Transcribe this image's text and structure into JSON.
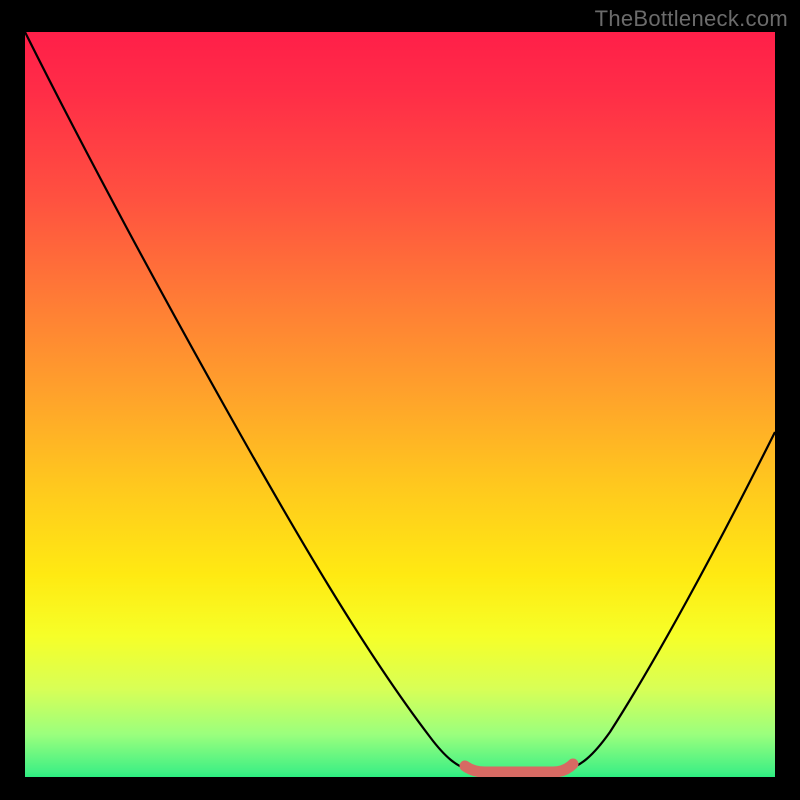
{
  "watermark": "TheBottleneck.com",
  "colors": {
    "background": "#000000",
    "gradient_top": "#ff1f49",
    "gradient_mid": "#ffea12",
    "gradient_bottom": "#00e676",
    "curve": "#000000",
    "marker": "#d76a63",
    "watermark": "#6b6b6b"
  },
  "chart_data": {
    "type": "line",
    "title": "",
    "xlabel": "",
    "ylabel": "",
    "xlim": [
      0,
      100
    ],
    "ylim": [
      0,
      100
    ],
    "series": [
      {
        "name": "curve",
        "x": [
          0,
          10,
          20,
          30,
          40,
          50,
          57,
          60,
          65,
          70,
          75,
          80,
          90,
          100
        ],
        "y": [
          100,
          84,
          67,
          51,
          35,
          18,
          5,
          2,
          0.5,
          0.5,
          2,
          8,
          27,
          47
        ]
      }
    ],
    "marker_region": {
      "x_start": 59,
      "x_end": 73,
      "y": 0.8,
      "note": "Flat minimum band highlighted"
    },
    "gradient_stops": [
      {
        "pos": 0.0,
        "color": "#ff1f49"
      },
      {
        "pos": 0.22,
        "color": "#ff5140"
      },
      {
        "pos": 0.48,
        "color": "#ffa22b"
      },
      {
        "pos": 0.72,
        "color": "#ffea12"
      },
      {
        "pos": 0.87,
        "color": "#d8ff56"
      },
      {
        "pos": 1.0,
        "color": "#00e676"
      }
    ]
  }
}
